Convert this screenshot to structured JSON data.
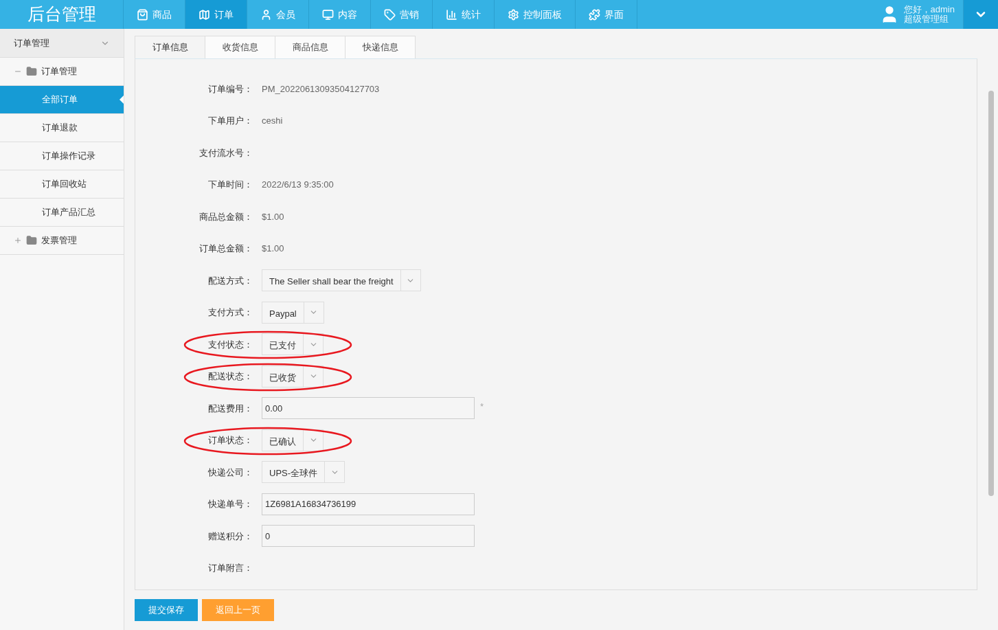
{
  "brand": "后台管理",
  "nav": [
    {
      "label": "商品",
      "selected": false
    },
    {
      "label": "订单",
      "selected": true
    },
    {
      "label": "会员",
      "selected": false
    },
    {
      "label": "内容",
      "selected": false
    },
    {
      "label": "营销",
      "selected": false
    },
    {
      "label": "统计",
      "selected": false
    },
    {
      "label": "控制面板",
      "selected": false
    },
    {
      "label": "界面",
      "selected": false
    }
  ],
  "user": {
    "greeting": "您好，admin",
    "role": "超级管理组"
  },
  "sidebar": {
    "title": "订单管理",
    "groups": [
      {
        "label": "订单管理",
        "expanded": true,
        "children": [
          {
            "label": "全部订单",
            "selected": true
          },
          {
            "label": "订单退款",
            "selected": false
          },
          {
            "label": "订单操作记录",
            "selected": false
          },
          {
            "label": "订单回收站",
            "selected": false
          },
          {
            "label": "订单产品汇总",
            "selected": false
          }
        ]
      },
      {
        "label": "发票管理",
        "expanded": false
      }
    ]
  },
  "tabs": [
    {
      "label": "订单信息",
      "selected": true
    },
    {
      "label": "收货信息",
      "selected": false
    },
    {
      "label": "商品信息",
      "selected": false
    },
    {
      "label": "快递信息",
      "selected": false
    }
  ],
  "form": [
    {
      "label": "订单编号：",
      "kind": "text",
      "value": "PM_20220613093504127703",
      "circled": false
    },
    {
      "label": "下单用户：",
      "kind": "text",
      "value": "ceshi",
      "circled": false
    },
    {
      "label": "支付流水号：",
      "kind": "text",
      "circled": false
    },
    {
      "label": "下单时间：",
      "kind": "text",
      "value": "2022/6/13 9:35:00",
      "circled": false
    },
    {
      "label": "商品总金额：",
      "kind": "text",
      "value": "$1.00",
      "circled": false
    },
    {
      "label": "订单总金额：",
      "kind": "text",
      "value": "$1.00",
      "circled": false
    },
    {
      "label": "配送方式：",
      "kind": "select",
      "value": "The Seller shall bear the freight",
      "circled": false
    },
    {
      "label": "支付方式：",
      "kind": "select",
      "value": "Paypal",
      "circled": false
    },
    {
      "label": "支付状态：",
      "kind": "select",
      "value": "已支付",
      "circled": true
    },
    {
      "label": "配送状态：",
      "kind": "select",
      "value": "已收货",
      "circled": true
    },
    {
      "label": "配送费用：",
      "kind": "input",
      "value": "0.00",
      "required": "*",
      "circled": false
    },
    {
      "label": "订单状态：",
      "kind": "select",
      "value": "已确认",
      "circled": true
    },
    {
      "label": "快递公司：",
      "kind": "select",
      "value": "UPS-全球件",
      "circled": false
    },
    {
      "label": "快递单号：",
      "kind": "input",
      "value": "1Z6981A16834736199",
      "circled": false
    },
    {
      "label": "赠送积分：",
      "kind": "input",
      "value": "0",
      "circled": false
    },
    {
      "label": "订单附言：",
      "kind": "text",
      "circled": false
    }
  ],
  "buttons": [
    {
      "label": "提交保存",
      "kind": "primary"
    },
    {
      "label": "返回上一页",
      "kind": "secondary"
    }
  ]
}
